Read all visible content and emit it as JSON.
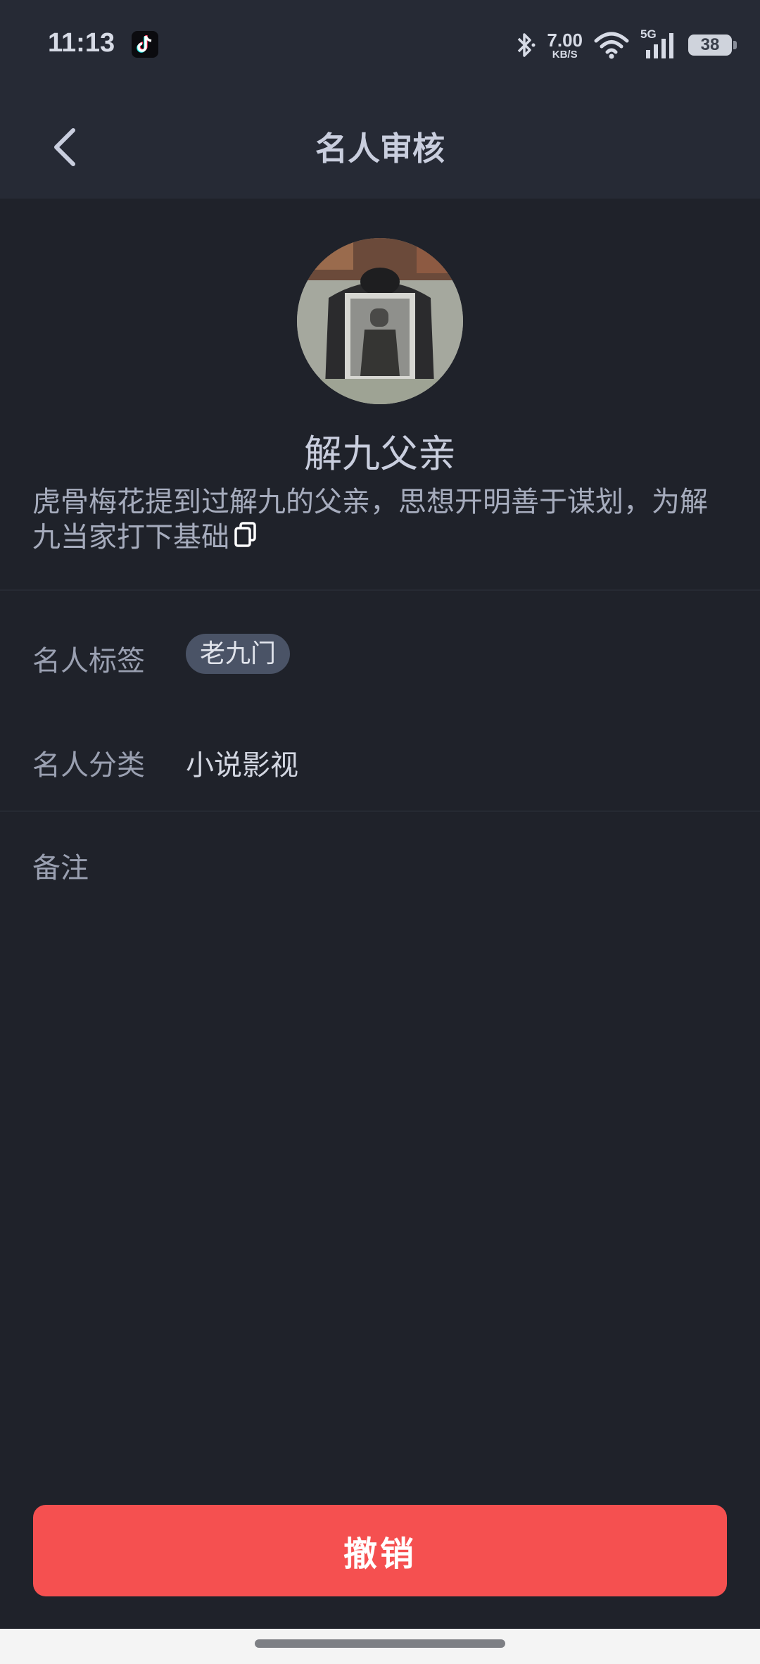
{
  "status_bar": {
    "time": "11:13",
    "app_icon": "tiktok-icon",
    "net_speed_value": "7.00",
    "net_speed_unit": "KB/S",
    "network": "5G",
    "battery": "38"
  },
  "nav": {
    "title": "名人审核",
    "back_icon": "chevron-left-icon"
  },
  "profile": {
    "name": "解九父亲",
    "description": "虎骨梅花提到过解九的父亲，思想开明善于谋划，为解九当家打下基础"
  },
  "fields": {
    "tag_label": "名人标签",
    "tag_value": "老九门",
    "category_label": "名人分类",
    "category_value": "小说影视",
    "remark_label": "备注"
  },
  "actions": {
    "cancel_label": "撤销"
  },
  "colors": {
    "background": "#1f222a",
    "header": "#262a35",
    "accent": "#f55050",
    "tag_bg": "#4a5366"
  }
}
